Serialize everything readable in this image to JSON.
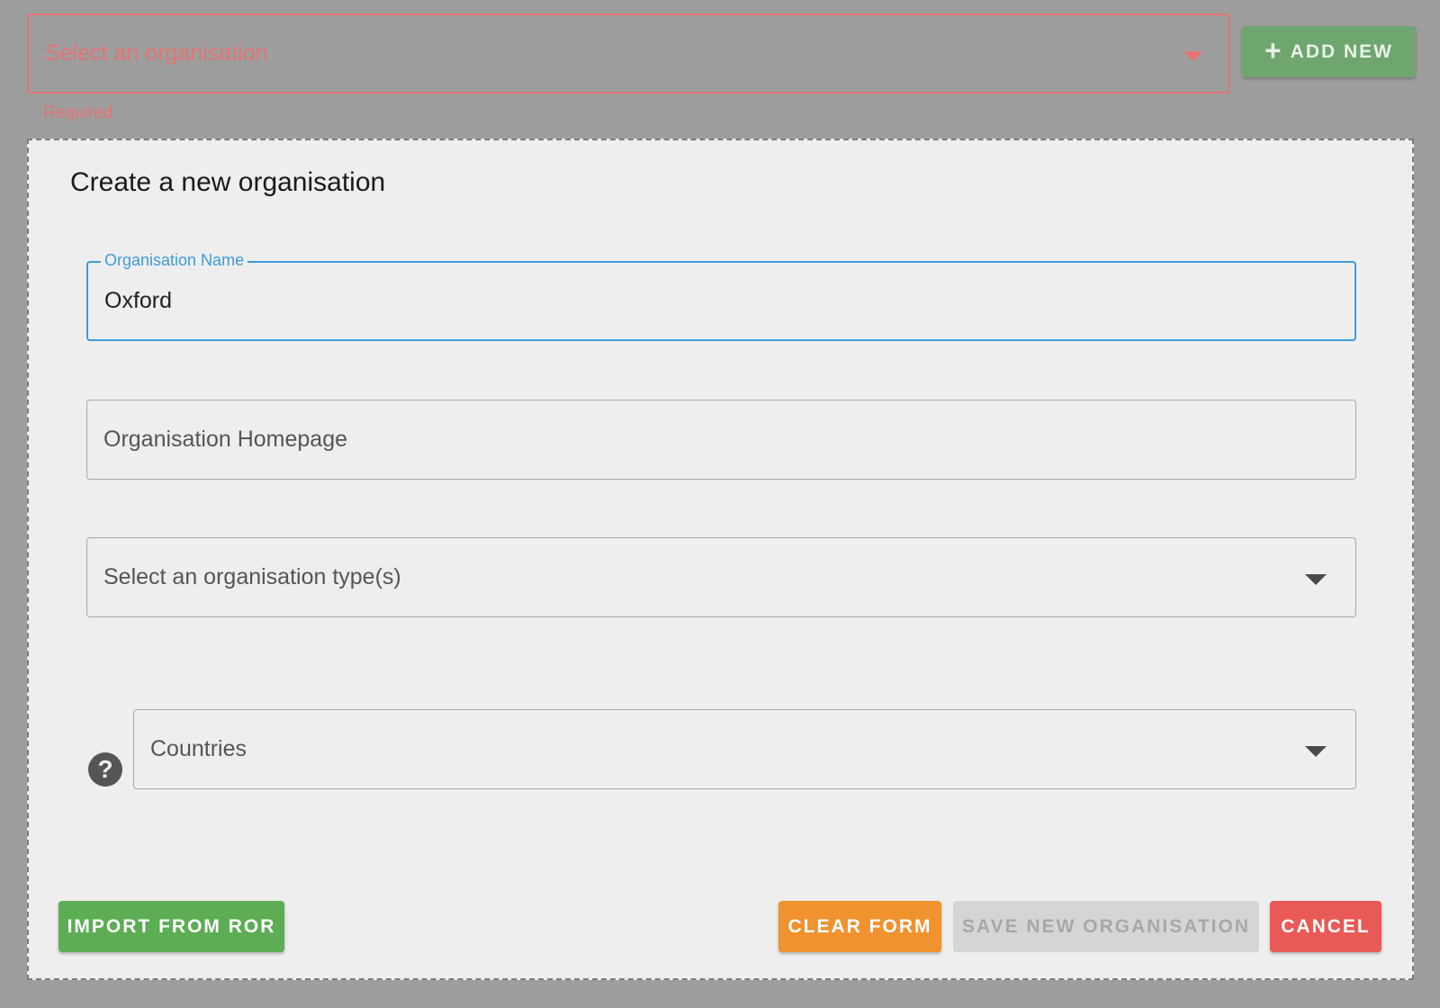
{
  "org_selector": {
    "placeholder": "Select an organisation",
    "error_text": "Required",
    "add_new_label": "ADD NEW"
  },
  "dialog": {
    "title": "Create a new organisation",
    "fields": {
      "name": {
        "label": "Organisation Name",
        "value": "Oxford"
      },
      "homepage": {
        "placeholder": "Organisation Homepage"
      },
      "type": {
        "placeholder": "Select an organisation type(s)"
      },
      "countries": {
        "placeholder": "Countries"
      }
    },
    "buttons": {
      "import": "IMPORT FROM ROR",
      "clear": "CLEAR FORM",
      "save": "SAVE NEW ORGANISATION",
      "cancel": "CANCEL"
    }
  },
  "icons": {
    "add": "plus-icon",
    "dropdown": "chevron-down-icon",
    "help": "help-circle-icon"
  },
  "colors": {
    "error": "#e57373",
    "focus": "#3d9bd9",
    "import": "#5cad54",
    "clear": "#f0922e",
    "save_disabled": "#d5d5d5",
    "cancel": "#e95a57",
    "add_new": "#6fa56f"
  }
}
